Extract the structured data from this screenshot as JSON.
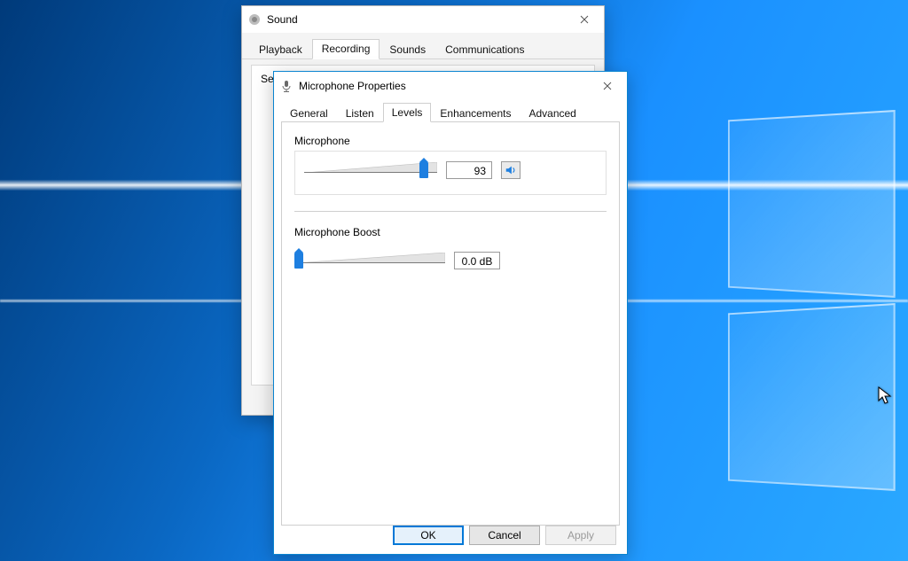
{
  "sound_window": {
    "title": "Sound",
    "tabs": [
      "Playback",
      "Recording",
      "Sounds",
      "Communications"
    ],
    "active_tab_index": 1,
    "instruction_prefix": "Sel"
  },
  "mic_window": {
    "title": "Microphone Properties",
    "tabs": [
      "General",
      "Listen",
      "Levels",
      "Enhancements",
      "Advanced"
    ],
    "active_tab_index": 2,
    "sections": {
      "microphone": {
        "label": "Microphone",
        "value": "93",
        "slider_percent": 93
      },
      "boost": {
        "label": "Microphone Boost",
        "value": "0.0 dB",
        "slider_percent": 0
      }
    },
    "buttons": {
      "ok": "OK",
      "cancel": "Cancel",
      "apply": "Apply"
    }
  }
}
